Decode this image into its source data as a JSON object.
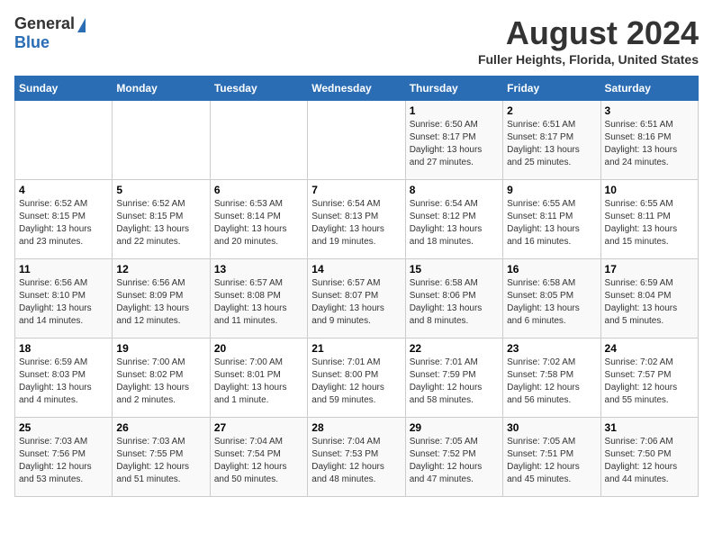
{
  "header": {
    "logo_general": "General",
    "logo_blue": "Blue",
    "title": "August 2024",
    "subtitle": "Fuller Heights, Florida, United States"
  },
  "calendar": {
    "days_of_week": [
      "Sunday",
      "Monday",
      "Tuesday",
      "Wednesday",
      "Thursday",
      "Friday",
      "Saturday"
    ],
    "weeks": [
      {
        "days": [
          {
            "num": "",
            "info": ""
          },
          {
            "num": "",
            "info": ""
          },
          {
            "num": "",
            "info": ""
          },
          {
            "num": "",
            "info": ""
          },
          {
            "num": "1",
            "info": "Sunrise: 6:50 AM\nSunset: 8:17 PM\nDaylight: 13 hours and 27 minutes."
          },
          {
            "num": "2",
            "info": "Sunrise: 6:51 AM\nSunset: 8:17 PM\nDaylight: 13 hours and 25 minutes."
          },
          {
            "num": "3",
            "info": "Sunrise: 6:51 AM\nSunset: 8:16 PM\nDaylight: 13 hours and 24 minutes."
          }
        ]
      },
      {
        "days": [
          {
            "num": "4",
            "info": "Sunrise: 6:52 AM\nSunset: 8:15 PM\nDaylight: 13 hours and 23 minutes."
          },
          {
            "num": "5",
            "info": "Sunrise: 6:52 AM\nSunset: 8:15 PM\nDaylight: 13 hours and 22 minutes."
          },
          {
            "num": "6",
            "info": "Sunrise: 6:53 AM\nSunset: 8:14 PM\nDaylight: 13 hours and 20 minutes."
          },
          {
            "num": "7",
            "info": "Sunrise: 6:54 AM\nSunset: 8:13 PM\nDaylight: 13 hours and 19 minutes."
          },
          {
            "num": "8",
            "info": "Sunrise: 6:54 AM\nSunset: 8:12 PM\nDaylight: 13 hours and 18 minutes."
          },
          {
            "num": "9",
            "info": "Sunrise: 6:55 AM\nSunset: 8:11 PM\nDaylight: 13 hours and 16 minutes."
          },
          {
            "num": "10",
            "info": "Sunrise: 6:55 AM\nSunset: 8:11 PM\nDaylight: 13 hours and 15 minutes."
          }
        ]
      },
      {
        "days": [
          {
            "num": "11",
            "info": "Sunrise: 6:56 AM\nSunset: 8:10 PM\nDaylight: 13 hours and 14 minutes."
          },
          {
            "num": "12",
            "info": "Sunrise: 6:56 AM\nSunset: 8:09 PM\nDaylight: 13 hours and 12 minutes."
          },
          {
            "num": "13",
            "info": "Sunrise: 6:57 AM\nSunset: 8:08 PM\nDaylight: 13 hours and 11 minutes."
          },
          {
            "num": "14",
            "info": "Sunrise: 6:57 AM\nSunset: 8:07 PM\nDaylight: 13 hours and 9 minutes."
          },
          {
            "num": "15",
            "info": "Sunrise: 6:58 AM\nSunset: 8:06 PM\nDaylight: 13 hours and 8 minutes."
          },
          {
            "num": "16",
            "info": "Sunrise: 6:58 AM\nSunset: 8:05 PM\nDaylight: 13 hours and 6 minutes."
          },
          {
            "num": "17",
            "info": "Sunrise: 6:59 AM\nSunset: 8:04 PM\nDaylight: 13 hours and 5 minutes."
          }
        ]
      },
      {
        "days": [
          {
            "num": "18",
            "info": "Sunrise: 6:59 AM\nSunset: 8:03 PM\nDaylight: 13 hours and 4 minutes."
          },
          {
            "num": "19",
            "info": "Sunrise: 7:00 AM\nSunset: 8:02 PM\nDaylight: 13 hours and 2 minutes."
          },
          {
            "num": "20",
            "info": "Sunrise: 7:00 AM\nSunset: 8:01 PM\nDaylight: 13 hours and 1 minute."
          },
          {
            "num": "21",
            "info": "Sunrise: 7:01 AM\nSunset: 8:00 PM\nDaylight: 12 hours and 59 minutes."
          },
          {
            "num": "22",
            "info": "Sunrise: 7:01 AM\nSunset: 7:59 PM\nDaylight: 12 hours and 58 minutes."
          },
          {
            "num": "23",
            "info": "Sunrise: 7:02 AM\nSunset: 7:58 PM\nDaylight: 12 hours and 56 minutes."
          },
          {
            "num": "24",
            "info": "Sunrise: 7:02 AM\nSunset: 7:57 PM\nDaylight: 12 hours and 55 minutes."
          }
        ]
      },
      {
        "days": [
          {
            "num": "25",
            "info": "Sunrise: 7:03 AM\nSunset: 7:56 PM\nDaylight: 12 hours and 53 minutes."
          },
          {
            "num": "26",
            "info": "Sunrise: 7:03 AM\nSunset: 7:55 PM\nDaylight: 12 hours and 51 minutes."
          },
          {
            "num": "27",
            "info": "Sunrise: 7:04 AM\nSunset: 7:54 PM\nDaylight: 12 hours and 50 minutes."
          },
          {
            "num": "28",
            "info": "Sunrise: 7:04 AM\nSunset: 7:53 PM\nDaylight: 12 hours and 48 minutes."
          },
          {
            "num": "29",
            "info": "Sunrise: 7:05 AM\nSunset: 7:52 PM\nDaylight: 12 hours and 47 minutes."
          },
          {
            "num": "30",
            "info": "Sunrise: 7:05 AM\nSunset: 7:51 PM\nDaylight: 12 hours and 45 minutes."
          },
          {
            "num": "31",
            "info": "Sunrise: 7:06 AM\nSunset: 7:50 PM\nDaylight: 12 hours and 44 minutes."
          }
        ]
      }
    ]
  }
}
